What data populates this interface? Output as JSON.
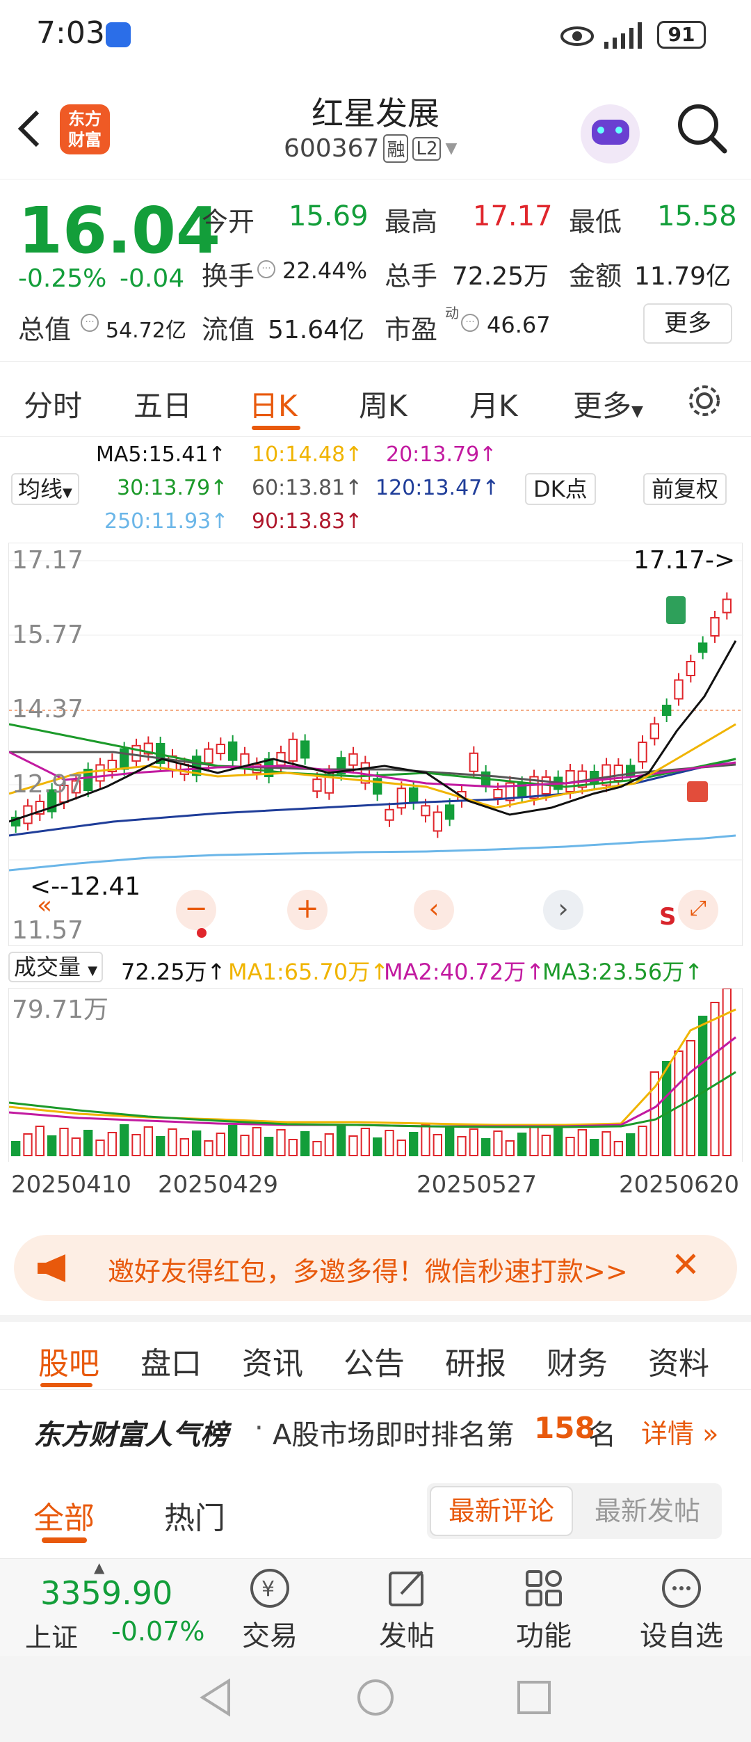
{
  "status": {
    "time": "7:03",
    "battery": "91"
  },
  "header": {
    "logo_line1": "东方",
    "logo_line2": "财富",
    "title": "红星发展",
    "code": "600367",
    "badge_rong": "融",
    "badge_l2": "L2"
  },
  "quote": {
    "price": "16.04",
    "change_pct": "-0.25%",
    "change": "-0.04",
    "open_label": "今开",
    "open": "15.69",
    "high_label": "最高",
    "high": "17.17",
    "low_label": "最低",
    "low": "15.58",
    "turnover_label": "换手",
    "turnover": "22.44%",
    "volume_label": "总手",
    "volume": "72.25万",
    "amount_label": "金额",
    "amount": "11.79亿",
    "mktcap_label": "总值",
    "mktcap": "54.72亿",
    "float_label": "流值",
    "float": "51.64亿",
    "pe_label": "市盈",
    "pe_sup": "动",
    "pe": "46.67",
    "more": "更多"
  },
  "tabs": [
    "分时",
    "五日",
    "日K",
    "周K",
    "月K",
    "更多"
  ],
  "ma": {
    "selector": "均线",
    "ma5": "MA5:15.41↑",
    "ma10": "10:14.48↑",
    "ma20": "20:13.79↑",
    "ma30": "30:13.79↑",
    "ma60": "60:13.81↑",
    "ma120": "120:13.47↑",
    "ma250": "250:11.93↑",
    "ma90": "90:13.83↑",
    "dk": "DK点",
    "adjust": "前复权"
  },
  "chart": {
    "y_top": "17.17",
    "y_2": "15.77",
    "y_3": "14.37",
    "y_4": "12.97",
    "y_bottom": "11.57",
    "max_marker": "17.17->",
    "min_marker": "<--12.41"
  },
  "colors": {
    "up": "#e0262c",
    "down": "#139e3a",
    "accent": "#e8590c",
    "ma5": "#111111",
    "ma10": "#f0b400",
    "ma20": "#c21aa0",
    "ma30": "#1c9a2a",
    "ma60": "#555555",
    "ma120": "#1f3d99",
    "ma250": "#6bb6e8",
    "ma90": "#b0192d"
  },
  "volume": {
    "selector": "成交量",
    "total": "72.25万↑",
    "ma1": "MA1:65.70万↑",
    "ma2": "MA2:40.72万↑",
    "ma3": "MA3:23.56万↑",
    "max": "79.71万"
  },
  "dates": [
    "20250410",
    "20250429",
    "20250527",
    "20250620"
  ],
  "banner": {
    "text": "邀好友得红包，多邀多得！微信秒速打款>>"
  },
  "bottom_tabs": [
    "股吧",
    "盘口",
    "资讯",
    "公告",
    "研报",
    "财务",
    "资料"
  ],
  "rank": {
    "brand": "东方财富人气榜",
    "text_pre": "A股市场即时排名第",
    "rank": "158",
    "text_post": "名",
    "detail": "详情"
  },
  "subtabs": {
    "all": "全部",
    "hot": "热门",
    "latest_comment": "最新评论",
    "latest_post": "最新发帖"
  },
  "bottombar": {
    "index_value": "3359.90",
    "index_name": "上证",
    "index_change": "-0.07%",
    "trade": "交易",
    "post": "发帖",
    "func": "功能",
    "watch": "设自选"
  }
}
